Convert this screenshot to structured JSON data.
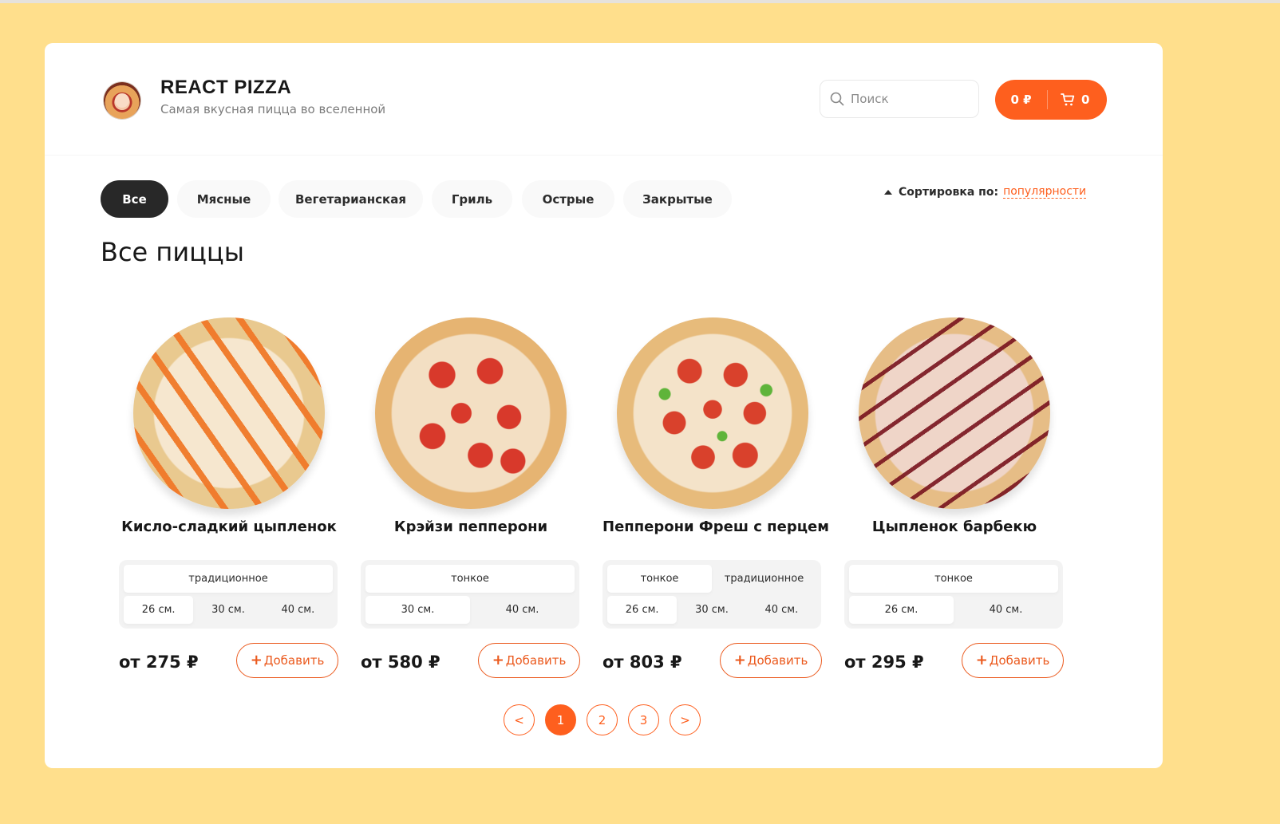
{
  "header": {
    "brand_title": "REACT PIZZA",
    "brand_subtitle": "Самая вкусная пицца во вселенной",
    "search_placeholder": "Поиск",
    "cart_price": "0 ₽",
    "cart_count": "0"
  },
  "categories": [
    {
      "label": "Все",
      "active": true
    },
    {
      "label": "Мясные"
    },
    {
      "label": "Вегетарианская"
    },
    {
      "label": "Гриль"
    },
    {
      "label": "Острые"
    },
    {
      "label": "Закрытые"
    }
  ],
  "sort": {
    "label": "Сортировка по:",
    "value": "популярности"
  },
  "page_title": "Все пиццы",
  "pizzas": [
    {
      "name": "Кисло-сладкий цыпленок",
      "types": [
        "традиционное"
      ],
      "sizes": [
        "26 см.",
        "30 см.",
        "40 см."
      ],
      "price": "от 275 ₽",
      "add_label": "Добавить"
    },
    {
      "name": "Крэйзи пепперони",
      "types": [
        "тонкое"
      ],
      "sizes": [
        "30 см.",
        "40 см."
      ],
      "price": "от 580 ₽",
      "add_label": "Добавить"
    },
    {
      "name": "Пепперони Фреш с перцем",
      "types": [
        "тонкое",
        "традиционное"
      ],
      "sizes": [
        "26 см.",
        "30 см.",
        "40 см."
      ],
      "price": "от 803 ₽",
      "add_label": "Добавить"
    },
    {
      "name": "Цыпленок барбекю",
      "types": [
        "тонкое"
      ],
      "sizes": [
        "26 см.",
        "40 см."
      ],
      "price": "от 295 ₽",
      "add_label": "Добавить"
    }
  ],
  "pagination": {
    "prev": "<",
    "pages": [
      "1",
      "2",
      "3"
    ],
    "next": ">",
    "current": "1"
  },
  "colors": {
    "accent": "#fe5f1e",
    "background": "#ffdf8c",
    "dark": "#282828"
  }
}
